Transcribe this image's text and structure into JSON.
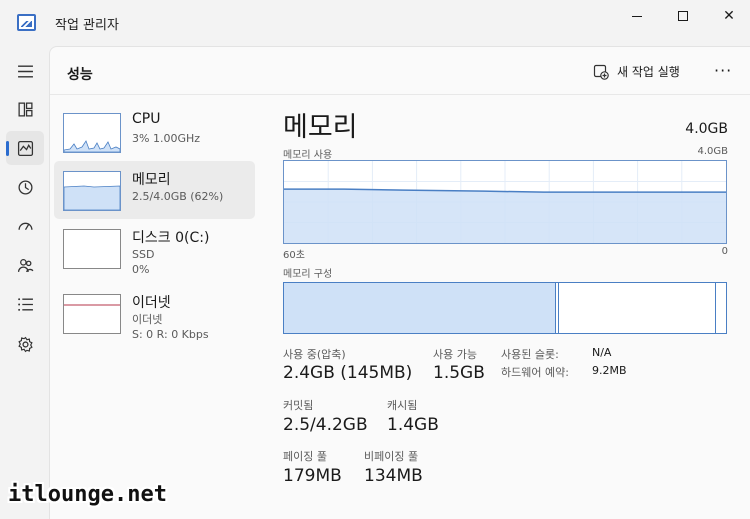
{
  "window": {
    "title": "작업 관리자"
  },
  "header": {
    "title": "성능",
    "run_task": "새 작업 실행",
    "more": "···"
  },
  "nav": [
    "menu-icon",
    "processes-icon",
    "performance-icon",
    "history-icon",
    "startup-icon",
    "users-icon",
    "details-icon",
    "services-icon"
  ],
  "sidebar": {
    "items": [
      {
        "name": "CPU",
        "sub1": "3% 1.00GHz",
        "sub2": ""
      },
      {
        "name": "메모리",
        "sub1": "2.5/4.0GB (62%)",
        "sub2": ""
      },
      {
        "name": "디스크 0(C:)",
        "sub1": "SSD",
        "sub2": "0%"
      },
      {
        "name": "이더넷",
        "sub1": "이더넷",
        "sub2": "S: 0 R: 0 Kbps"
      }
    ]
  },
  "main": {
    "title": "메모리",
    "total": "4.0GB",
    "usage_label": "메모리 사용",
    "usage_max": "4.0GB",
    "axis_left": "60초",
    "axis_right": "0",
    "composition_label": "메모리 구성",
    "usage_fraction": 0.62
  },
  "stats": {
    "in_use_label": "사용 중(압축)",
    "in_use_value": "2.4GB (145MB)",
    "available_label": "사용 가능",
    "available_value": "1.5GB",
    "committed_label": "커밋됨",
    "committed_value": "2.5/4.2GB",
    "cached_label": "캐시됨",
    "cached_value": "1.4GB",
    "paged_label": "페이징 풀",
    "paged_value": "179MB",
    "nonpaged_label": "비페이징 풀",
    "nonpaged_value": "134MB",
    "slots_label": "사용된 슬롯:",
    "slots_value": "N/A",
    "reserved_label": "하드웨어 예약:",
    "reserved_value": "9.2MB"
  },
  "watermark": "itlounge.net",
  "colors": {
    "accent": "#2b6ccf",
    "chart_line": "#4a7fc4",
    "chart_fill": "#cfe1f7"
  }
}
